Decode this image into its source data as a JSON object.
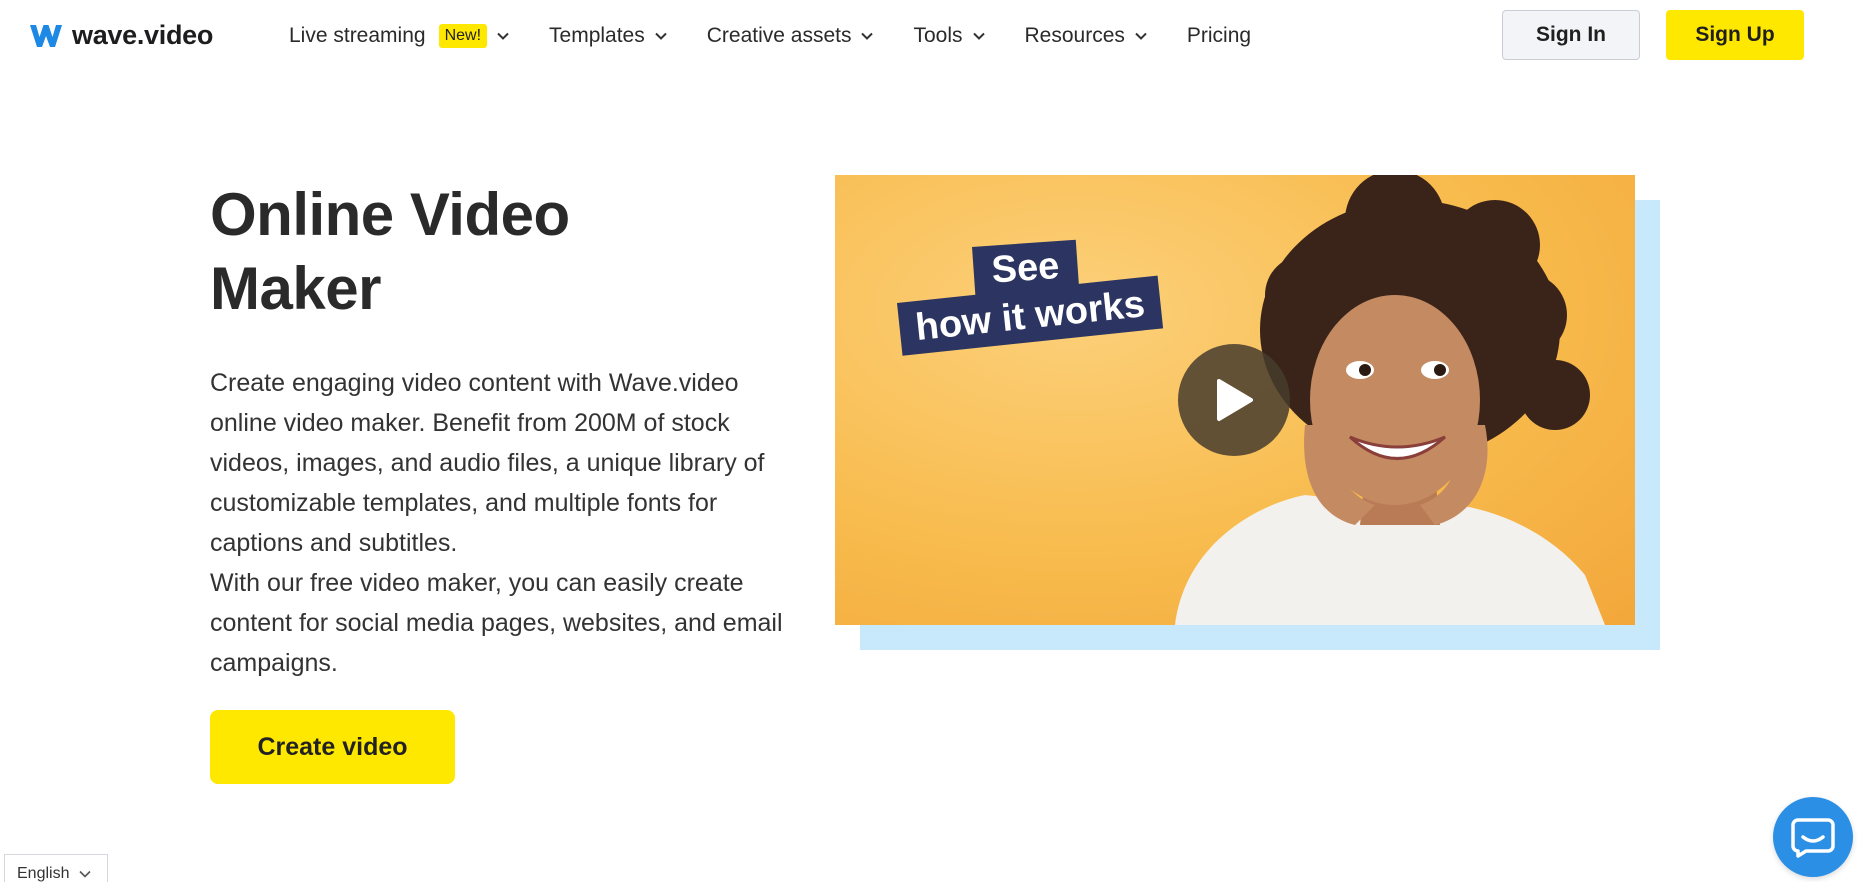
{
  "brand": {
    "name": "wave.video",
    "logo_icon": "wave-logo-icon",
    "accent_color": "#ffe800",
    "primary_blue": "#2b8fe6"
  },
  "nav": {
    "items": [
      {
        "label": "Live streaming",
        "badge": "New!",
        "has_dropdown": true
      },
      {
        "label": "Templates",
        "has_dropdown": true
      },
      {
        "label": "Creative assets",
        "has_dropdown": true
      },
      {
        "label": "Tools",
        "has_dropdown": true
      },
      {
        "label": "Resources",
        "has_dropdown": true
      },
      {
        "label": "Pricing",
        "has_dropdown": false
      }
    ]
  },
  "auth": {
    "sign_in": "Sign In",
    "sign_up": "Sign Up"
  },
  "hero": {
    "title_line1": "Online Video",
    "title_line2": "Maker",
    "paragraph1": "Create engaging video content with Wave.video online video maker. Benefit from 200M of stock videos, images, and audio files, a unique library of customizable templates, and multiple fonts for captions and subtitles.",
    "paragraph2": "With our free video maker, you can easily create content for social media pages, websites, and email campaigns.",
    "cta": "Create video"
  },
  "video": {
    "label_line1": "See",
    "label_line2": "how it works",
    "play_icon": "play-icon",
    "label_color": "#2c3561",
    "background_color": "#f8bb4d",
    "shadow_color": "#c7e9fb"
  },
  "footer": {
    "language": "English",
    "chat_icon": "chat-icon"
  }
}
